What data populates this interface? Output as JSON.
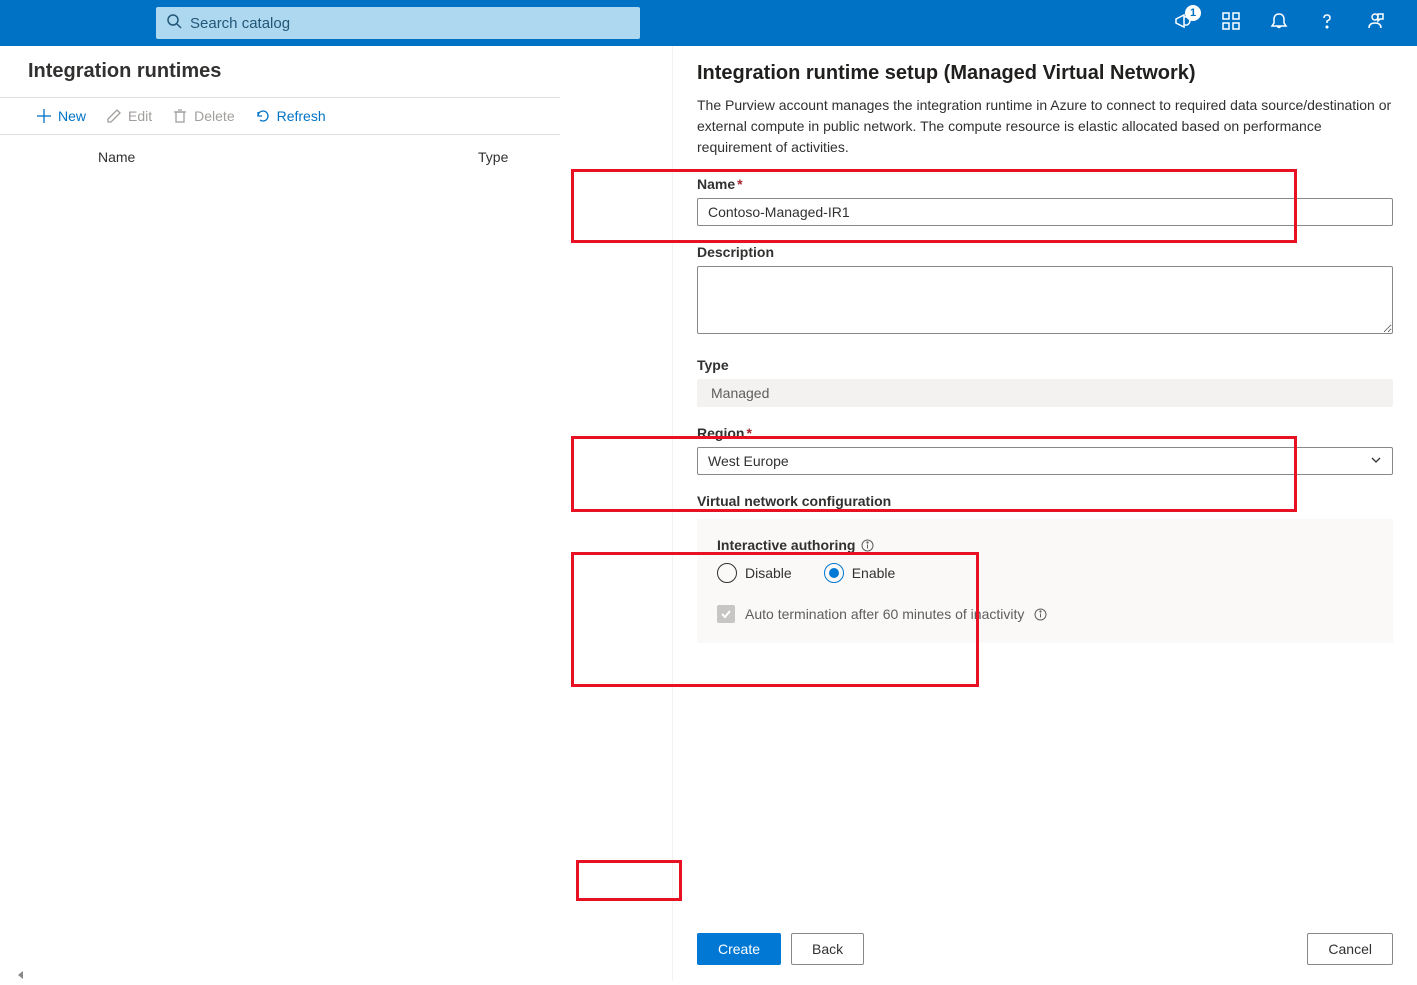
{
  "header": {
    "search_placeholder": "Search catalog",
    "badge": "1"
  },
  "left": {
    "title": "Integration runtimes",
    "toolbar": {
      "new": "New",
      "edit": "Edit",
      "delete": "Delete",
      "refresh": "Refresh"
    },
    "columns": {
      "name": "Name",
      "type": "Type"
    }
  },
  "panel": {
    "title": "Integration runtime setup (Managed Virtual Network)",
    "description": "The Purview account manages the integration runtime in Azure to connect to required data source/destination or external compute in public network. The compute resource is elastic allocated based on performance requirement of activities.",
    "fields": {
      "name_label": "Name",
      "name_value": "Contoso-Managed-IR1",
      "description_label": "Description",
      "description_value": "",
      "type_label": "Type",
      "type_value": "Managed",
      "region_label": "Region",
      "region_value": "West Europe",
      "vnet_label": "Virtual network configuration",
      "interactive_label": "Interactive authoring",
      "disable": "Disable",
      "enable": "Enable",
      "auto_term": "Auto termination after 60 minutes of inactivity"
    },
    "buttons": {
      "create": "Create",
      "back": "Back",
      "cancel": "Cancel"
    }
  }
}
